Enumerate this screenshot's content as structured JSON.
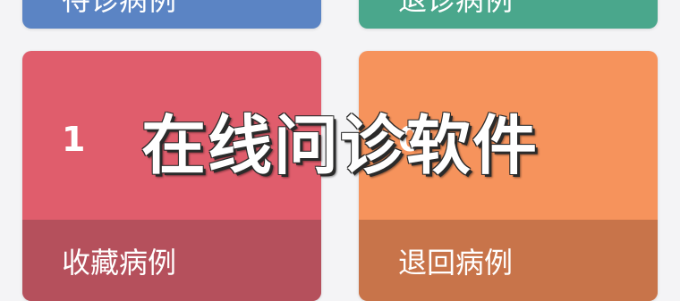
{
  "title_overlay": "在线问诊软件",
  "colors": {
    "background": "#f4f4f6",
    "card_blue": "#5b84c4",
    "card_teal": "#4aa78c",
    "card_red": "#e05d6c",
    "card_red_footer": "#b5505c",
    "card_orange": "#f6935c",
    "card_orange_footer": "#c8744a"
  },
  "top_cards": [
    {
      "label": "待诊病例"
    },
    {
      "label": "退诊病例"
    }
  ],
  "cards": [
    {
      "count": "1",
      "label": "收藏病例"
    },
    {
      "count": "0",
      "label": "退回病例"
    }
  ]
}
